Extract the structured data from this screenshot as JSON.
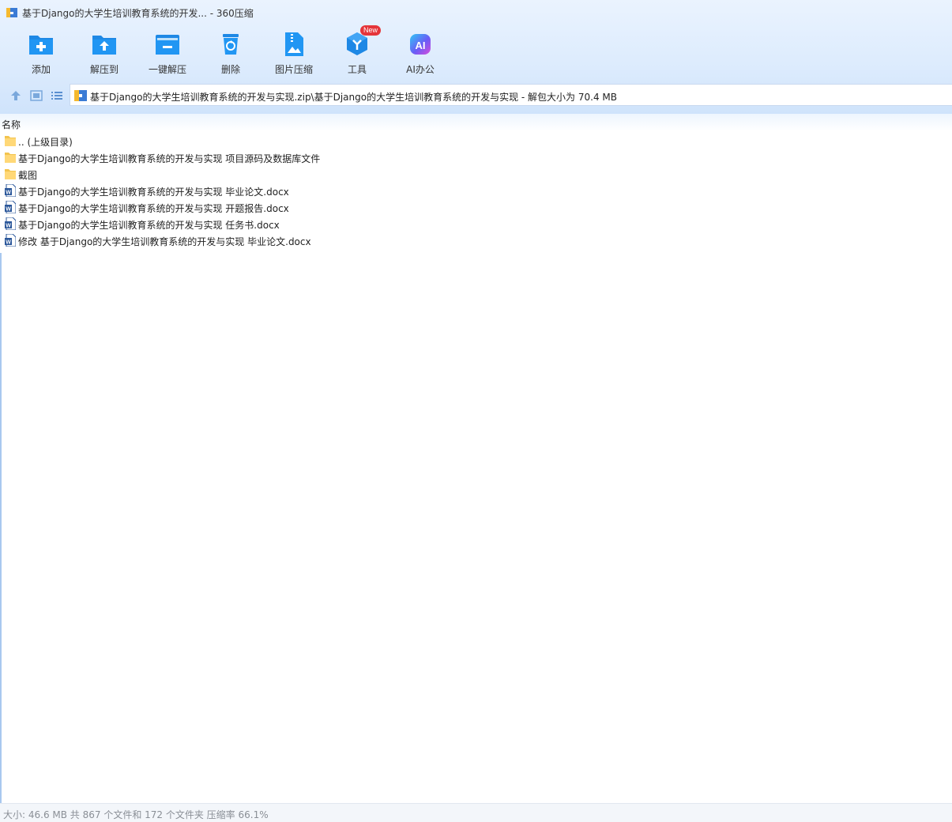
{
  "window": {
    "title": "基于Django的大学生培训教育系统的开发... - 360压缩"
  },
  "toolbar": {
    "items": [
      {
        "label": "添加",
        "icon": "add-folder-icon"
      },
      {
        "label": "解压到",
        "icon": "extract-to-icon"
      },
      {
        "label": "一键解压",
        "icon": "one-click-extract-icon"
      },
      {
        "label": "删除",
        "icon": "recycle-delete-icon"
      },
      {
        "label": "图片压缩",
        "icon": "image-compress-icon"
      },
      {
        "label": "工具",
        "icon": "tools-icon",
        "badge": "New"
      },
      {
        "label": "AI办公",
        "icon": "ai-office-icon"
      }
    ]
  },
  "nav": {
    "path": "基于Django的大学生培训教育系统的开发与实现.zip\\基于Django的大学生培训教育系统的开发与实现 - 解包大小为 70.4 MB"
  },
  "list": {
    "column_name": "名称",
    "files": [
      {
        "name": ".. (上级目录)",
        "type": "folder"
      },
      {
        "name": "基于Django的大学生培训教育系统的开发与实现 项目源码及数据库文件",
        "type": "folder"
      },
      {
        "name": "截图",
        "type": "folder"
      },
      {
        "name": "基于Django的大学生培训教育系统的开发与实现 毕业论文.docx",
        "type": "docx"
      },
      {
        "name": "基于Django的大学生培训教育系统的开发与实现 开题报告.docx",
        "type": "docx"
      },
      {
        "name": "基于Django的大学生培训教育系统的开发与实现 任务书.docx",
        "type": "docx"
      },
      {
        "name": "修改 基于Django的大学生培训教育系统的开发与实现 毕业论文.docx",
        "type": "docx"
      }
    ]
  },
  "status": {
    "text": "大小: 46.6 MB 共 867 个文件和 172 个文件夹 压缩率 66.1%"
  },
  "colors": {
    "accent": "#1e88e5",
    "folder": "#ffd877",
    "word": "#2b579a",
    "badge": "#e5353a"
  }
}
